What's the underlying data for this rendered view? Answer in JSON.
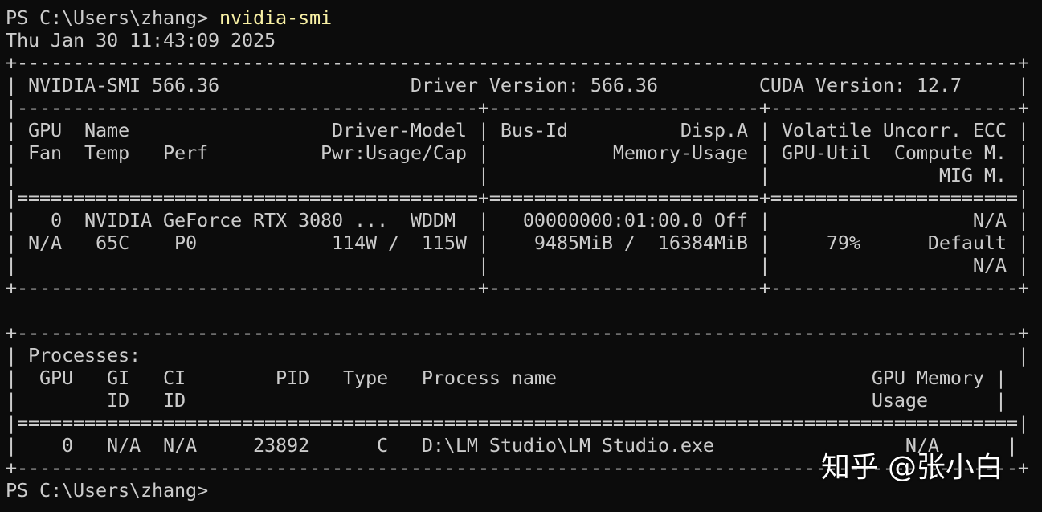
{
  "terminal": {
    "prompt1": "PS C:\\Users\\zhang> ",
    "command": "nvidia-smi",
    "timestamp": "Thu Jan 30 11:43:09 2025",
    "lines": [
      "+-----------------------------------------------------------------------------------------+",
      "| NVIDIA-SMI 566.36                 Driver Version: 566.36         CUDA Version: 12.7     |",
      "|-----------------------------------------+------------------------+----------------------+",
      "| GPU  Name                  Driver-Model | Bus-Id          Disp.A | Volatile Uncorr. ECC |",
      "| Fan  Temp   Perf          Pwr:Usage/Cap |           Memory-Usage | GPU-Util  Compute M. |",
      "|                                         |                        |               MIG M. |",
      "|=========================================+========================+======================|",
      "|   0  NVIDIA GeForce RTX 3080 ...  WDDM  |   00000000:01:00.0 Off |                  N/A |",
      "| N/A   65C    P0            114W /  115W |    9485MiB /  16384MiB |     79%      Default |",
      "|                                         |                        |                  N/A |",
      "+-----------------------------------------+------------------------+----------------------+",
      "",
      "+-----------------------------------------------------------------------------------------+",
      "| Processes:                                                                              |",
      "|  GPU   GI   CI        PID   Type   Process name                            GPU Memory |",
      "|        ID   ID                                                             Usage      |",
      "|=========================================================================================|",
      "|    0   N/A  N/A     23892      C   D:\\LM Studio\\LM Studio.exe                 N/A      |",
      "+-----------------------------------------------------------------------------------------+"
    ],
    "prompt2": "PS C:\\Users\\zhang> "
  },
  "watermark": {
    "text": "知乎 @张小白"
  }
}
